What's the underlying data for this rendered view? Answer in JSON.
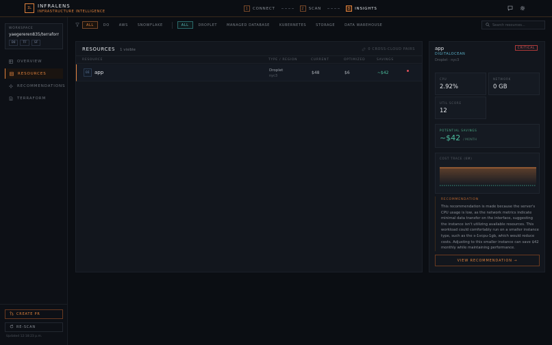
{
  "header": {
    "logo_text": "IL",
    "brand_name": "INFRALENS",
    "brand_sub": "INFRASTRUCTURE INTELLIGENCE",
    "steps": [
      {
        "num": "1",
        "label": "CONNECT"
      },
      {
        "num": "2",
        "label": "SCAN"
      },
      {
        "num": "3",
        "label": "INSIGHTS"
      }
    ],
    "active_step": 3
  },
  "sidebar": {
    "workspace_label": "WORKSPACE",
    "workspace_name": "yaegereren835/terraform...",
    "chips": [
      "DO",
      "TF",
      "SF"
    ],
    "nav": [
      {
        "label": "OVERVIEW",
        "icon": "grid-icon"
      },
      {
        "label": "RESOURCES",
        "icon": "database-icon",
        "active": true
      },
      {
        "label": "RECOMMENDATIONS",
        "icon": "sparkle-icon"
      },
      {
        "label": "TERRAFORM",
        "icon": "file-icon"
      }
    ],
    "create_pr": "CREATE PR",
    "rescan": "RE-SCAN",
    "updated": "Updated 12:18:23 p.m."
  },
  "filters": {
    "providers": [
      "ALL",
      "DO",
      "AWS",
      "SNOWFLAKE"
    ],
    "types": [
      "ALL",
      "DROPLET",
      "MANAGED DATABASE",
      "KUBERNETES",
      "STORAGE",
      "DATA WAREHOUSE"
    ]
  },
  "search": {
    "placeholder": "Search resources..."
  },
  "resources": {
    "title": "RESOURCES",
    "count": "1 visible",
    "cross_pairs": "0 CROSS-CLOUD PAIRS",
    "columns": [
      "RESOURCE",
      "TYPE / REGION",
      "CURRENT",
      "OPTIMIZED",
      "SAVINGS"
    ],
    "rows": [
      {
        "badge": "DI",
        "name": "app",
        "type": "Droplet",
        "region": "nyc3",
        "current": "$48",
        "optimized": "$6",
        "savings": "~$42"
      }
    ]
  },
  "detail": {
    "name": "app",
    "provider": "DIGITALOCEAN",
    "sub": "Droplet · nyc3",
    "severity": "CRITICAL",
    "metrics": [
      {
        "label": "CPU",
        "value": "2.92%"
      },
      {
        "label": "NETWORK",
        "value": "0 GB"
      },
      {
        "label": "UTIL SCORE",
        "value": "12"
      }
    ],
    "savings_label": "POTENTIAL SAVINGS",
    "savings_value": "~$42",
    "savings_unit": "/ MONTH",
    "trace_label": "COST TRACE (6M)",
    "rec_label": "RECOMMENDATION",
    "rec_text": "This recommendation is made because the server's CPU usage is low, as the network metrics indicate minimal data transfer on the interface, suggesting the instance isn't utilizing available resources. This workload could comfortably run on a smaller instance type, such as the s-1vcpu-1gb, which would reduce costs. Adjusting to this smaller instance can save $42 monthly while maintaining performance.",
    "view_rec": "VIEW RECOMMENDATION →"
  },
  "colors": {
    "accent": "#e2833d",
    "savings": "#4cc0a0",
    "critical": "#e06060",
    "provider": "#5ab0c8"
  }
}
